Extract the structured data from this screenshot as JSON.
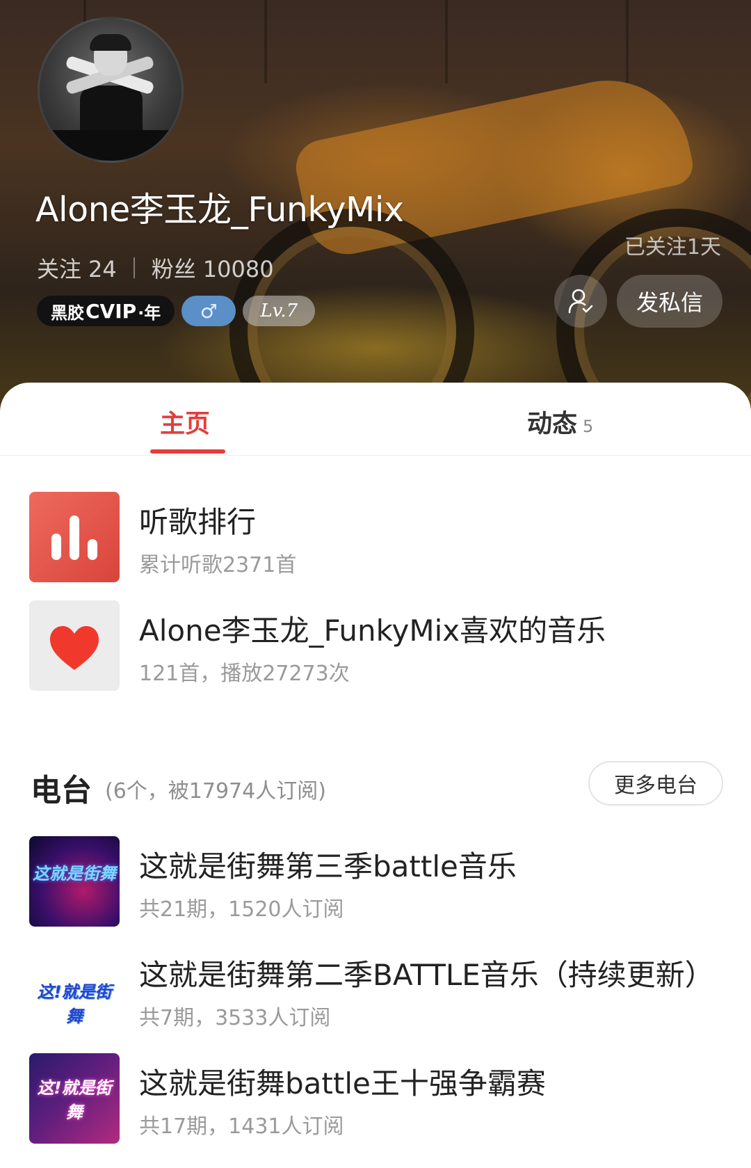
{
  "profile": {
    "username": "Alone李玉龙_FunkyMix",
    "following_label": "关注",
    "following_count": "24",
    "followers_label": "粉丝",
    "followers_count": "10080",
    "followed_since": "已关注1天",
    "vip_prefix": "黑胶",
    "vip_logo": "CVIP",
    "vip_suffix": "·年",
    "gender_symbol": "♂",
    "level": "Lv.7",
    "message_button": "发私信"
  },
  "tabs": {
    "home": "主页",
    "feed": "动态",
    "feed_count": "5"
  },
  "features": [
    {
      "title": "听歌排行",
      "subtitle": "累计听歌2371首",
      "icon": "bar-chart-icon"
    },
    {
      "title": "Alone李玉龙_FunkyMix喜欢的音乐",
      "subtitle": "121首，播放27273次",
      "icon": "heart-icon"
    }
  ],
  "radio": {
    "title": "电台",
    "meta": "(6个，被17974人订阅)",
    "more_button": "更多电台",
    "items": [
      {
        "title": "这就是街舞第三季battle音乐",
        "subtitle": "共21期，1520人订阅",
        "cover_text": "这就是街舞"
      },
      {
        "title": "这就是街舞第二季BATTLE音乐（持续更新）",
        "subtitle": "共7期，3533人订阅",
        "cover_text": "这!就是街舞"
      },
      {
        "title": "这就是街舞battle王十强争霸赛",
        "subtitle": "共17期，1431人订阅",
        "cover_text": "这!就是街舞"
      }
    ]
  },
  "colors": {
    "accent": "#e43d3d",
    "secondary_text": "#9a9a9a"
  }
}
